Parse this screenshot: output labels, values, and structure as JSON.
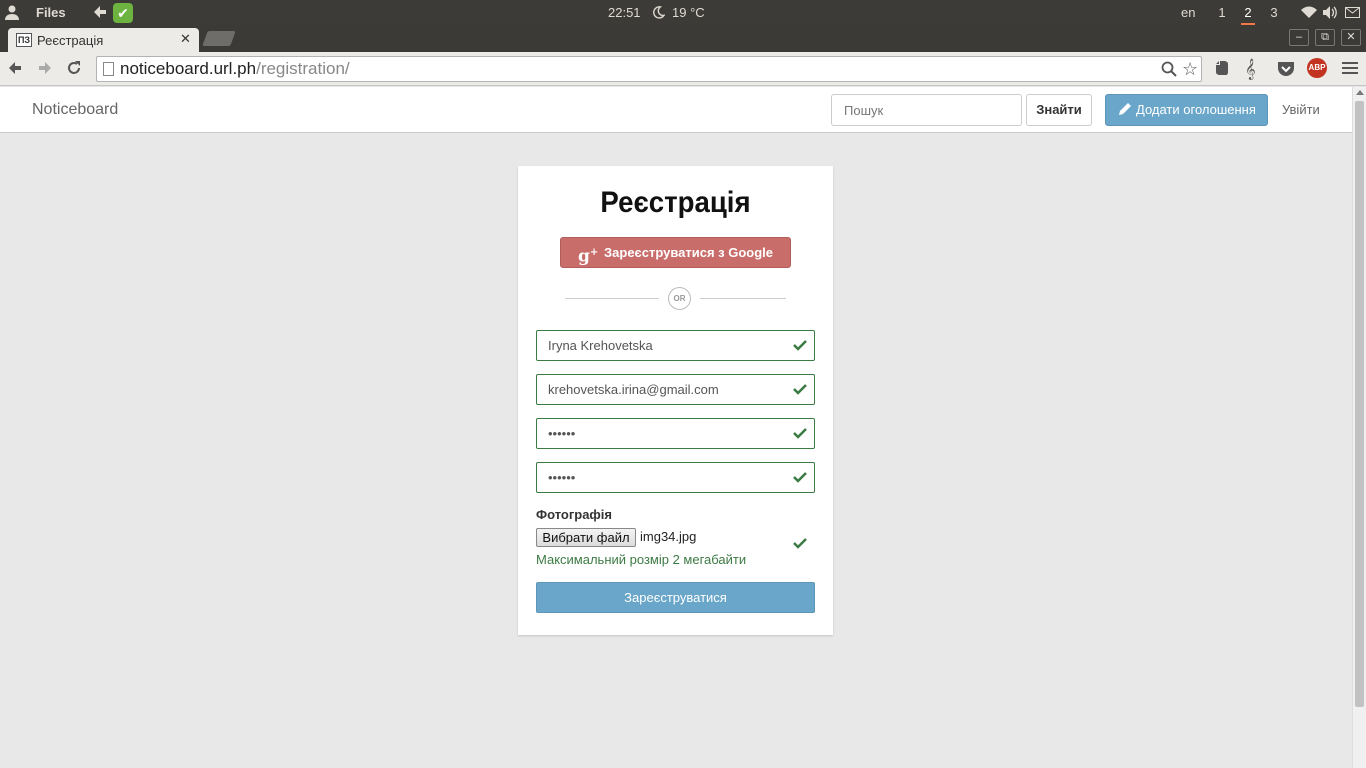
{
  "system_panel": {
    "files_label": "Files",
    "clock": "22:51",
    "temperature": "19 °C",
    "language": "en",
    "workspaces": [
      "1",
      "2",
      "3"
    ],
    "active_workspace": "2"
  },
  "browser": {
    "tab_title": "Реєстрація",
    "tab_favicon_text": "ПЗ",
    "url_host": "noticeboard.url.ph",
    "url_path": "/registration/",
    "abp_label": "ABP"
  },
  "navbar": {
    "brand": "Noticeboard",
    "search_placeholder": "Пошук",
    "search_button": "Знайти",
    "add_button": "Додати оголошення",
    "login_link": "Увійти"
  },
  "form": {
    "title": "Реєстрація",
    "google_button": "Зареєструватися з Google",
    "or_label": "OR",
    "name_value": "Iryna Krehovetska",
    "email_value": "krehovetska.irina@gmail.com",
    "password_value": "••••••",
    "password_confirm_value": "••••••",
    "photo_label": "Фотографія",
    "file_button": "Вибрати файл",
    "file_name": "img34.jpg",
    "help_text": "Максимальний розмір 2 мегабайти",
    "submit_button": "Зареєструватися"
  },
  "colors": {
    "primary": "#6aa6c9",
    "google": "#c86d6a",
    "success": "#3c7a43",
    "tab_indicator": "#f07746"
  }
}
